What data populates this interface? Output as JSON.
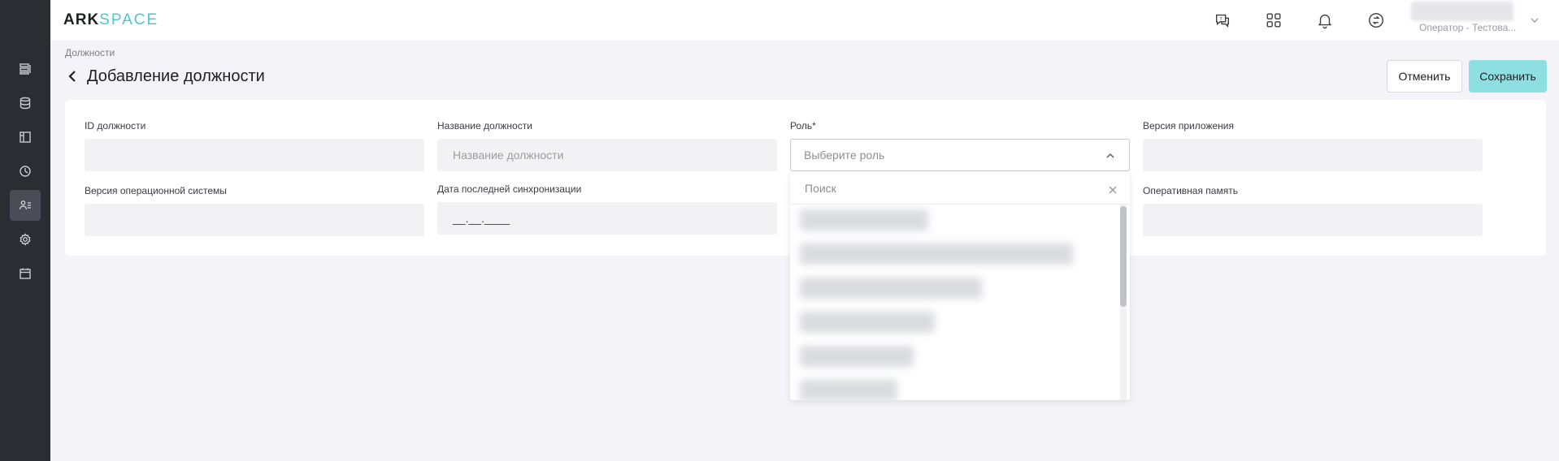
{
  "header": {
    "logo_primary": "ARK",
    "logo_secondary": "SPACE",
    "user": {
      "role": "Оператор - Тестова..."
    },
    "icons": [
      "support-chat-icon",
      "apps-grid-icon",
      "bell-icon",
      "sync-icon"
    ]
  },
  "sidebar": {
    "items": [
      {
        "icon": "list-icon",
        "active": false
      },
      {
        "icon": "database-icon",
        "active": false
      },
      {
        "icon": "layout-icon",
        "active": false
      },
      {
        "icon": "clock-icon",
        "active": false
      },
      {
        "icon": "users-icon",
        "active": true
      },
      {
        "icon": "settings-icon",
        "active": false
      },
      {
        "icon": "calendar-icon",
        "active": false
      }
    ]
  },
  "page": {
    "breadcrumb": "Должности",
    "title": "Добавление должности",
    "cancel_label": "Отменить",
    "save_label": "Сохранить"
  },
  "form": {
    "position_id": {
      "label": "ID должности",
      "value": ""
    },
    "position_name": {
      "label": "Название должности",
      "placeholder": "Название должности",
      "value": ""
    },
    "role": {
      "label": "Роль*",
      "placeholder": "Выберите роль",
      "search_placeholder": "Поиск"
    },
    "app_version": {
      "label": "Версия приложения",
      "value": ""
    },
    "os_version": {
      "label": "Версия операционной системы",
      "value": ""
    },
    "last_sync": {
      "label": "Дата последней синхронизации",
      "mask": "__.__.____"
    },
    "ram": {
      "label": "Оперативная память",
      "value": ""
    }
  },
  "colors": {
    "accent": "#8ddfe2",
    "logo_accent": "#4cc9cf",
    "sidebar_bg": "#2b2d33"
  }
}
